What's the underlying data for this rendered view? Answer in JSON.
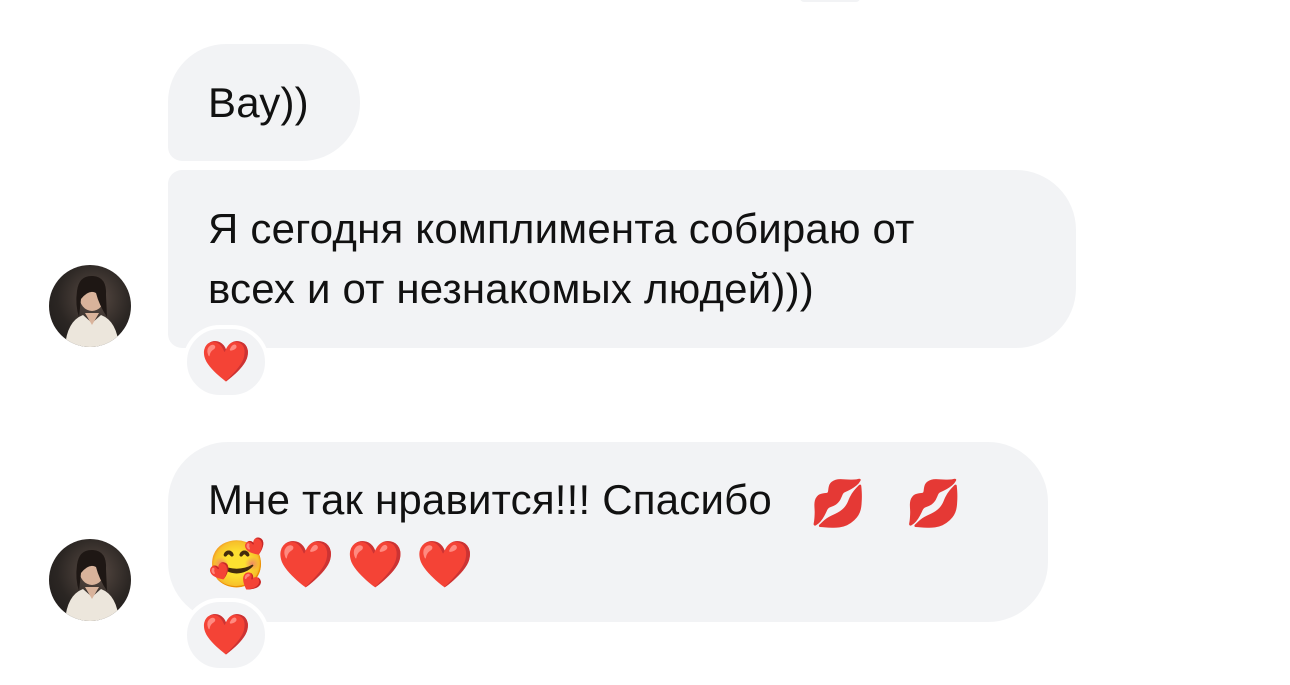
{
  "messages": [
    {
      "text_lines": [
        "Вау))"
      ]
    },
    {
      "text_lines": [
        "Я сегодня комплимента собираю от",
        "всех и от незнакомых людей)))"
      ],
      "reaction": "❤️"
    },
    {
      "text_lines": [
        "Мне так нравится!!! Спасибо"
      ],
      "emoji_line1": [
        "💋",
        "💋"
      ],
      "emoji_line2": [
        "🥰",
        "❤️",
        "❤️",
        "❤️"
      ],
      "reaction": "❤️"
    }
  ],
  "icons": {
    "avatar": "profile-photo-avatar",
    "reaction_heart": "red-heart-icon",
    "kiss": "kiss-mark-icon",
    "smiling_face_hearts": "smiling-face-with-hearts-icon"
  },
  "colors": {
    "bubble_bg": "#f2f3f5",
    "text": "#111111",
    "heart": "#e3192c"
  }
}
